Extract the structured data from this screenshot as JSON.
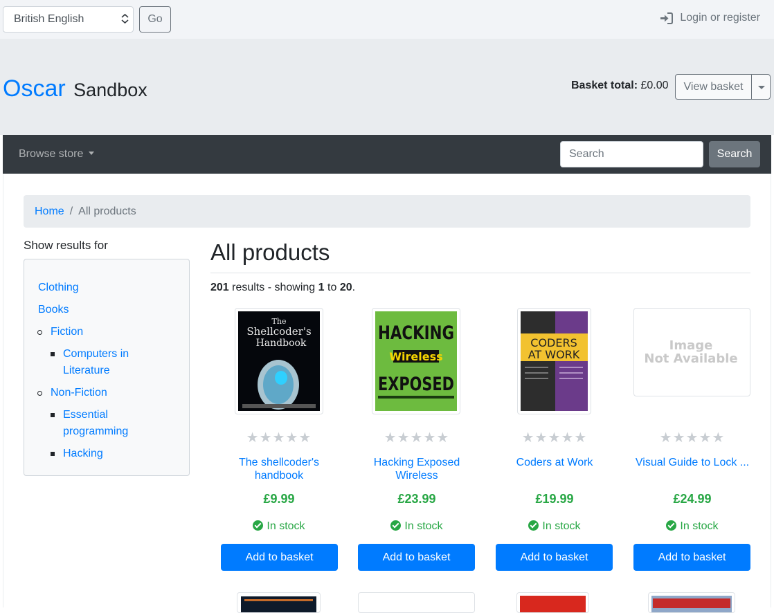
{
  "topbar": {
    "language_value": "British English",
    "go_label": "Go",
    "login_label": "Login or register"
  },
  "header": {
    "brand_main": "Oscar",
    "brand_sub": "Sandbox",
    "basket_total_label": "Basket total:",
    "basket_total_value": "£0.00",
    "view_basket_label": "View basket"
  },
  "navbar": {
    "browse_label": "Browse store",
    "search_placeholder": "Search",
    "search_button": "Search"
  },
  "breadcrumb": {
    "home": "Home",
    "separator": "/",
    "current": "All products"
  },
  "sidebar": {
    "heading": "Show results for",
    "categories": [
      {
        "label": "Clothing"
      },
      {
        "label": "Books"
      },
      {
        "label": "Fiction"
      },
      {
        "label_line1": "Computers in",
        "label_line2": "Literature"
      },
      {
        "label": "Non-Fiction"
      },
      {
        "label_line1": "Essential",
        "label_line2": "programming"
      },
      {
        "label": "Hacking"
      }
    ]
  },
  "main": {
    "title": "All products",
    "results_count": "201",
    "results_text": "results - showing",
    "from": "1",
    "to_word": "to",
    "to": "20",
    "period": "."
  },
  "products": [
    {
      "title_line1": "The shellcoder's",
      "title_line2": "handbook",
      "price": "£9.99",
      "stock": "In stock",
      "button": "Add to basket",
      "rating": 0,
      "cover_title1": "The",
      "cover_title2": "Shellcoder's",
      "cover_title3": "Handbook"
    },
    {
      "title_line1": "Hacking Exposed",
      "title_line2": "Wireless",
      "price": "£23.99",
      "stock": "In stock",
      "button": "Add to basket",
      "rating": 0,
      "cover_title1": "HACKING",
      "cover_title2": "Wireless",
      "cover_title3": "EXPOSED"
    },
    {
      "title_line1": "Coders at Work",
      "title_line2": "",
      "price": "£19.99",
      "stock": "In stock",
      "button": "Add to basket",
      "rating": 0,
      "cover_title1": "CODERS",
      "cover_title2": "AT WORK"
    },
    {
      "title_line1": "Visual Guide to Lock ...",
      "title_line2": "",
      "price": "£24.99",
      "stock": "In stock",
      "button": "Add to basket",
      "rating": 0,
      "cover_title1": "Image",
      "cover_title2": "Not Available"
    }
  ],
  "colors": {
    "link": "#007bff",
    "price": "#28a745",
    "navbar": "#343a40",
    "header_bg": "#e9ecef"
  }
}
